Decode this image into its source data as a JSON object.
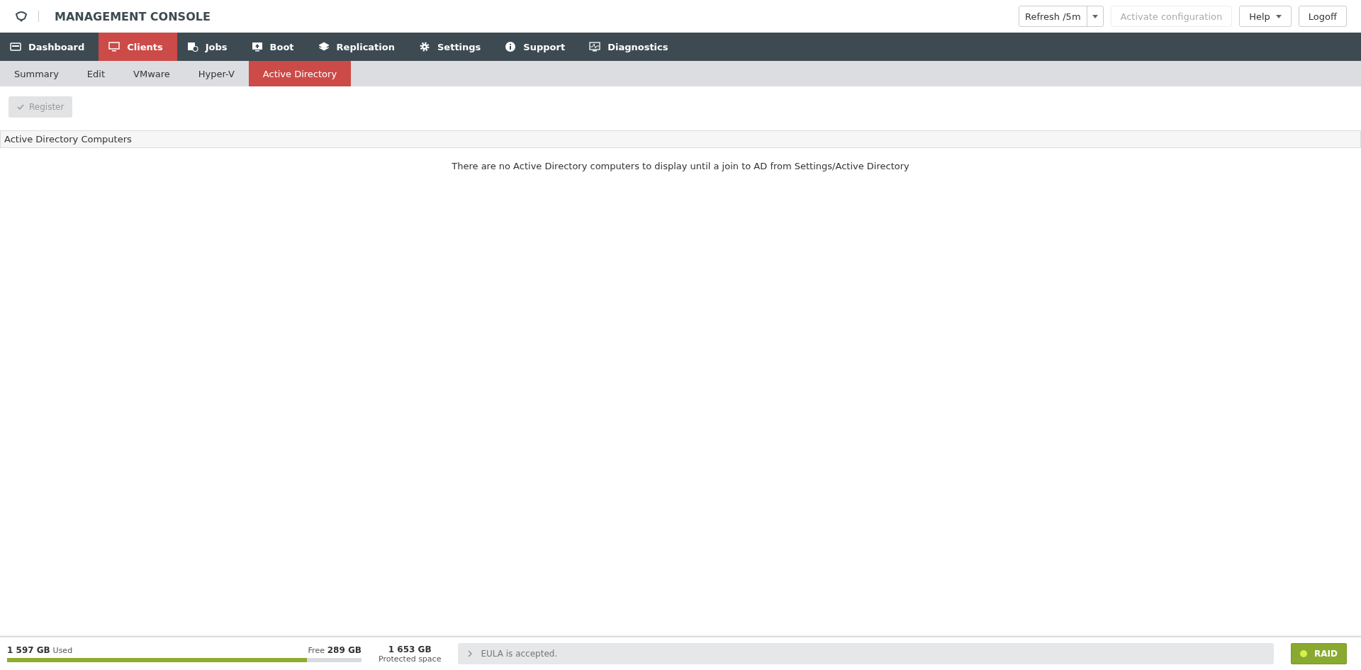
{
  "header": {
    "title": "MANAGEMENT CONSOLE",
    "refresh": {
      "label": "Refresh /5m"
    },
    "activate": {
      "label": "Activate configuration",
      "disabled": true
    },
    "help": {
      "label": "Help"
    },
    "logoff": {
      "label": "Logoff"
    }
  },
  "nav": [
    {
      "label": "Dashboard",
      "kind": "dashboard",
      "selected": false
    },
    {
      "label": "Clients",
      "kind": "monitor",
      "selected": true
    },
    {
      "label": "Jobs",
      "kind": "jobs",
      "selected": false
    },
    {
      "label": "Boot",
      "kind": "boot",
      "selected": false
    },
    {
      "label": "Replication",
      "kind": "layers",
      "selected": false
    },
    {
      "label": "Settings",
      "kind": "gear",
      "selected": false
    },
    {
      "label": "Support",
      "kind": "info",
      "selected": false
    },
    {
      "label": "Diagnostics",
      "kind": "pulse",
      "selected": false
    }
  ],
  "subtabs": [
    {
      "label": "Summary",
      "selected": false
    },
    {
      "label": "Edit",
      "selected": false
    },
    {
      "label": "VMware",
      "selected": false
    },
    {
      "label": "Hyper-V",
      "selected": false
    },
    {
      "label": "Active Directory",
      "selected": true
    }
  ],
  "register": {
    "label": "Register",
    "disabled": true
  },
  "section": {
    "title": "Active Directory Computers",
    "message": "There are no Active Directory computers to display until a join to AD from Settings/Active Directory"
  },
  "footer": {
    "used": "1 597 GB",
    "used_label": "Used",
    "free_label": "Free",
    "free": "289 GB",
    "level": 0.846,
    "protected": "1 653 GB",
    "protected_label": "Protected space",
    "message": "EULA is accepted.",
    "raid": {
      "label": "RAID",
      "color": "#d4f24a"
    }
  }
}
